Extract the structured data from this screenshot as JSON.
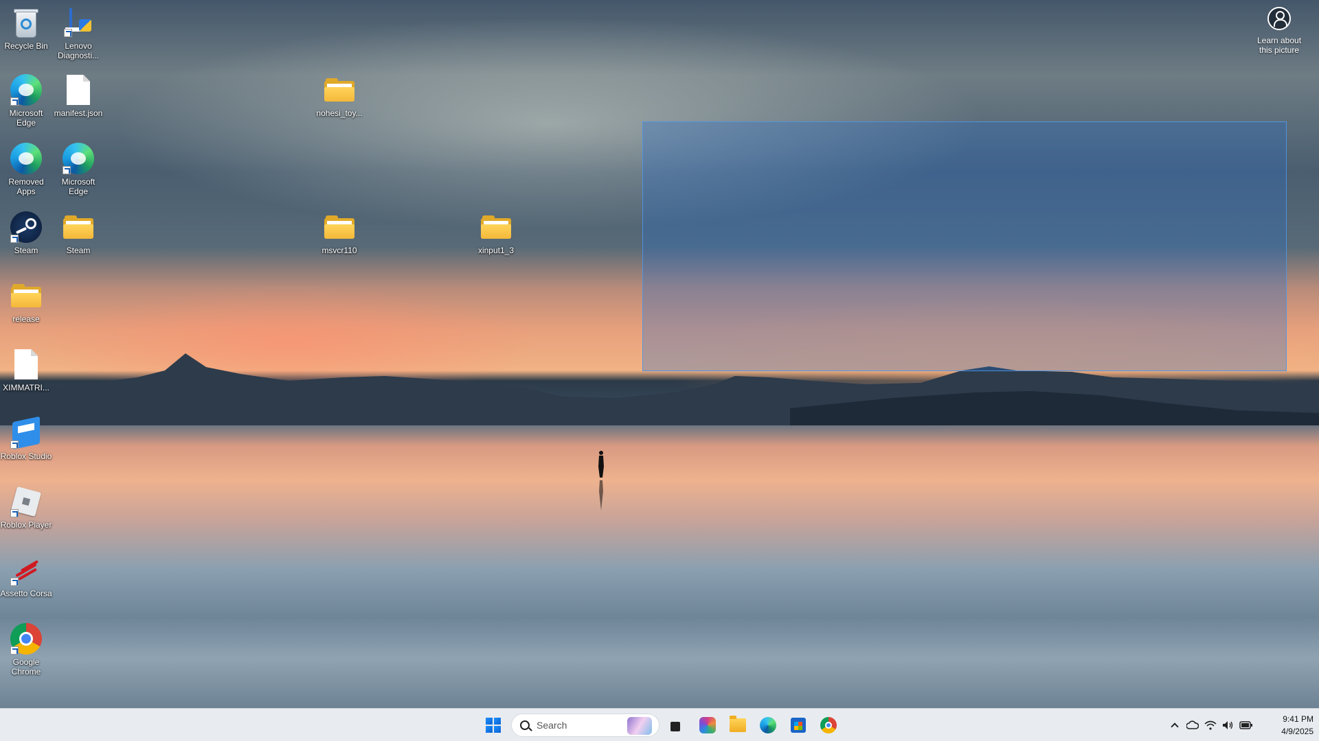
{
  "desktop": {
    "icons": [
      {
        "label": "Recycle Bin"
      },
      {
        "label": "Lenovo Diagnosti..."
      },
      {
        "label": "Microsoft Edge"
      },
      {
        "label": "manifest.json"
      },
      {
        "label": "nohesi_toy..."
      },
      {
        "label": "Removed Apps"
      },
      {
        "label": "Microsoft Edge"
      },
      {
        "label": "Steam"
      },
      {
        "label": "Steam"
      },
      {
        "label": "msvcr110"
      },
      {
        "label": "xinput1_3"
      },
      {
        "label": "release"
      },
      {
        "label": "XIMMATRI..."
      },
      {
        "label": "Roblox Studio"
      },
      {
        "label": "Roblox Player"
      },
      {
        "label": "Assetto Corsa"
      },
      {
        "label": "Google Chrome"
      }
    ],
    "learn_about_picture": "Learn about this picture"
  },
  "taskbar": {
    "search_placeholder": "Search",
    "pinned": [
      "start-icon",
      "search",
      "task-view-icon",
      "microsoft-365-icon",
      "file-explorer-icon",
      "edge-icon",
      "microsoft-store-icon",
      "chrome-icon"
    ],
    "tray_icons": [
      "show-hidden-icons",
      "onedrive-icon",
      "wifi-icon",
      "volume-icon",
      "battery-icon"
    ],
    "time": "9:41 PM",
    "date": "4/9/2025"
  }
}
